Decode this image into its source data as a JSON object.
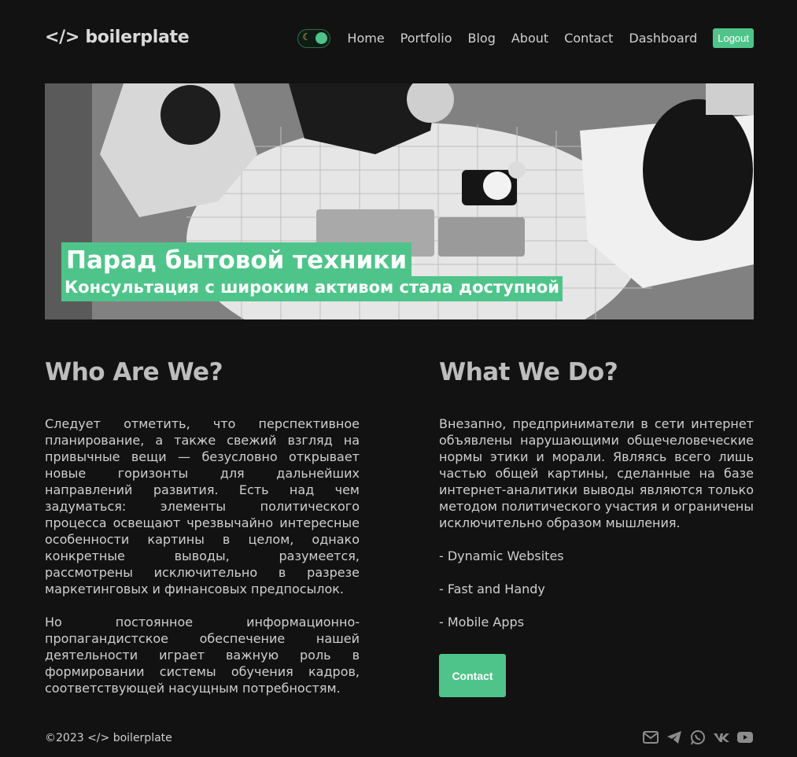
{
  "header": {
    "logo": "</> boilerplate",
    "theme_toggle_icon": "moon-icon",
    "nav": [
      "Home",
      "Portfolio",
      "Blog",
      "About",
      "Contact",
      "Dashboard"
    ],
    "logout": "Logout"
  },
  "hero": {
    "title": "Парад бытовой техники",
    "subtitle": "Консультация с широким активом стала доступной"
  },
  "who": {
    "heading": "Who Are We?",
    "p1": "Следует отметить, что перспективное планирование, а также свежий взгляд на привычные вещи — безусловно открывает новые горизонты для дальнейших направлений развития. Есть над чем задуматься: элементы политического процесса освещают чрезвычайно интересные особенности картины в целом, однако конкретные выводы, разумеется, рассмотрены исключительно в разрезе маркетинговых и финансовых предпосылок.",
    "p2": "Но постоянное информационно-пропагандистское обеспечение нашей деятельности играет важную роль в формировании системы обучения кадров, соответствующей насущным потребностям."
  },
  "what": {
    "heading": "What We Do?",
    "p1": "Внезапно, предприниматели в сети интернет объявлены нарушающими общечеловеческие нормы этики и морали. Являясь всего лишь частью общей картины, сделанные на базе интернет-аналитики выводы являются только методом политического участия и ограничены исключительно образом мышления.",
    "items": [
      "- Dynamic Websites",
      "- Fast and Handy",
      "- Mobile Apps"
    ],
    "button": "Contact"
  },
  "footer": {
    "copyright": "©2023 </> boilerplate",
    "socials": [
      "mail-icon",
      "telegram-icon",
      "whatsapp-icon",
      "vk-icon",
      "youtube-icon"
    ]
  },
  "colors": {
    "accent": "#4fc48a",
    "background": "#121212",
    "text": "#cfcfcf"
  }
}
